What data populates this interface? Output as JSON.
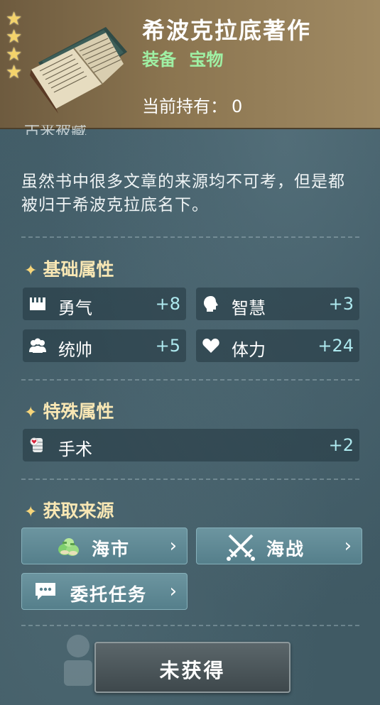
{
  "item": {
    "title": "希波克拉底著作",
    "tags": [
      "装备",
      "宝物"
    ],
    "hold_label": "当前持有：",
    "hold_value": "0",
    "stars": 4,
    "image_icon": "open-book-icon",
    "cut_text": "古来被藏"
  },
  "description": "虽然书中很多文章的来源均不可考，但是都被归于希波克拉底名下。",
  "basic_attrs": {
    "title": "基础属性",
    "items": [
      {
        "name": "勇气",
        "value": "+8",
        "icon": "courage-icon"
      },
      {
        "name": "智慧",
        "value": "+3",
        "icon": "wisdom-head-icon"
      },
      {
        "name": "统帅",
        "value": "+5",
        "icon": "command-people-icon"
      },
      {
        "name": "体力",
        "value": "+24",
        "icon": "heart-icon"
      }
    ]
  },
  "special_attrs": {
    "title": "特殊属性",
    "items": [
      {
        "name": "手术",
        "value": "+2",
        "icon": "surgery-bandage-icon"
      }
    ]
  },
  "sources": {
    "title": "获取来源",
    "items": [
      {
        "label": "海市",
        "icon": "money-bags-icon"
      },
      {
        "label": "海战",
        "icon": "crossed-swords-icon"
      },
      {
        "label": "委托任务",
        "icon": "chat-bubble-icon"
      }
    ]
  },
  "action": {
    "label": "未获得"
  },
  "colors": {
    "header_gold": "#8b7550",
    "tag_green": "#9ff0a4",
    "section_title": "#f8e7b4",
    "value_cyan": "#aee9ef",
    "button_teal": "#6c95a0"
  }
}
